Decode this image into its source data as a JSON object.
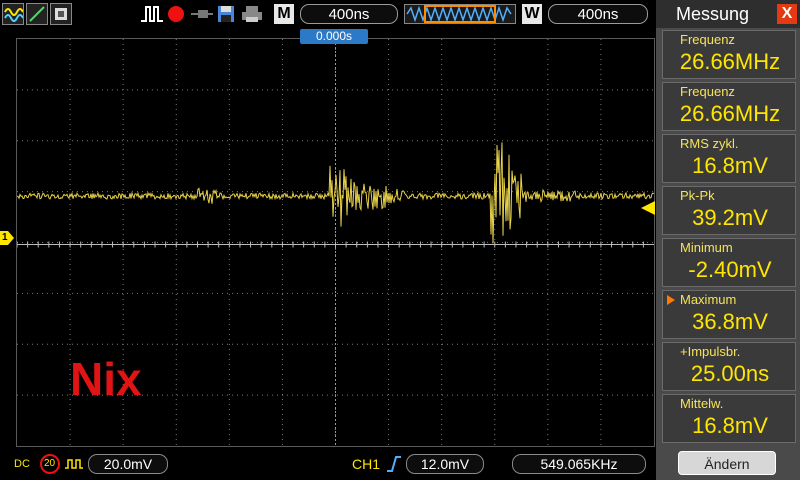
{
  "toolbar": {
    "timebase_main_label": "M",
    "timebase_main_value": "400ns",
    "window_label": "W",
    "window_value": "400ns",
    "icons": [
      "math-wave-icon",
      "cursor-icon",
      "display-mode-icon",
      "pulse-icon",
      "record-icon",
      "probe-icon",
      "save-icon",
      "print-icon",
      "waveform-preview-icon"
    ]
  },
  "screen": {
    "trigger_time": "0.000s",
    "overlay_text": "Nix",
    "channel_marker": "1"
  },
  "panel": {
    "title": "Messung",
    "close_label": "X",
    "measurements": [
      {
        "label": "Frequenz",
        "value": "26.66MHz"
      },
      {
        "label": "Frequenz",
        "value": "26.66MHz"
      },
      {
        "label": "RMS  zykl.",
        "value": "16.8mV"
      },
      {
        "label": "Pk-Pk",
        "value": "39.2mV"
      },
      {
        "label": "Minimum",
        "value": "-2.40mV"
      },
      {
        "label": "Maximum",
        "value": "36.8mV"
      },
      {
        "label": "+Impulsbr.",
        "value": "25.00ns"
      },
      {
        "label": "Mittelw.",
        "value": "16.8mV"
      }
    ],
    "change_button": "Ändern"
  },
  "status": {
    "coupling": "DC",
    "bandwidth_limit": "20",
    "ch_scale": "20.0mV",
    "trigger_channel": "CH1",
    "trigger_level": "12.0mV",
    "frequency": "549.065KHz"
  },
  "colors": {
    "trace": "#e7d14a",
    "grid": "#7a7a7a",
    "accent": "#ffe600",
    "panel_bg": "#4a4a4a",
    "close_bg": "#e23a12",
    "trigger_marker": "#2c79c8",
    "overlay_text": "#e01414"
  }
}
